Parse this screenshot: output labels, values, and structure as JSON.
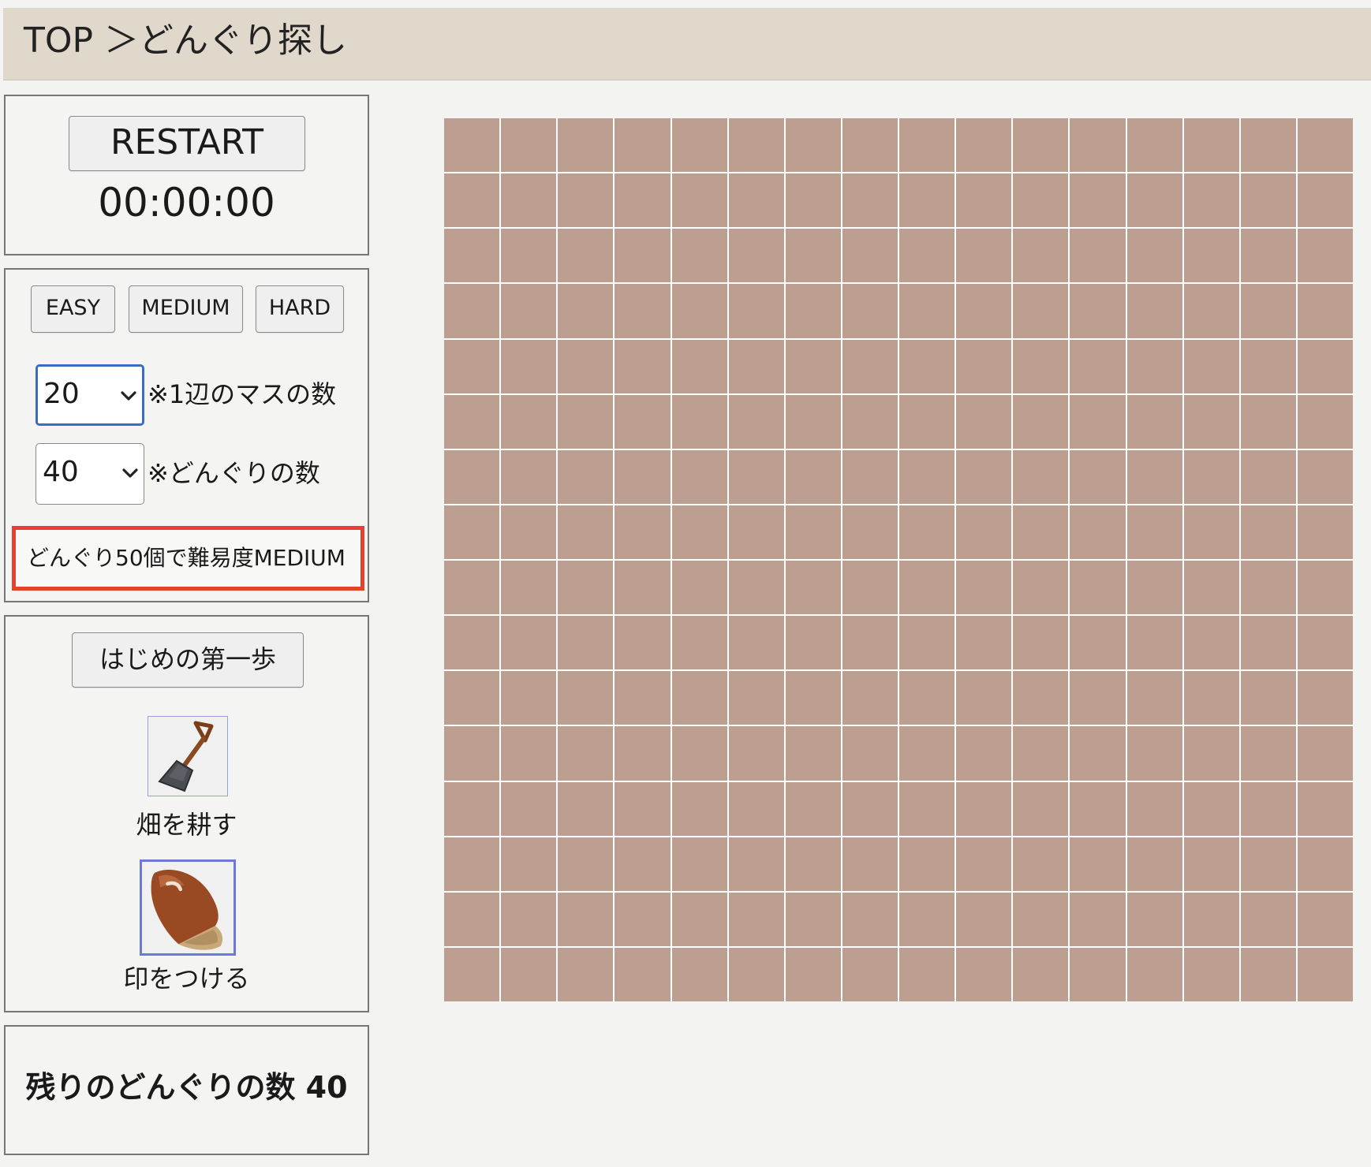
{
  "header": {
    "breadcrumb": "TOP ＞どんぐり探し"
  },
  "controls": {
    "restart_label": "RESTART",
    "timer": "00:00:00"
  },
  "difficulty": {
    "easy_label": "EASY",
    "medium_label": "MEDIUM",
    "hard_label": "HARD",
    "grid_size_value": "20",
    "grid_size_note": "※1辺のマスの数",
    "acorn_count_value": "40",
    "acorn_count_note": "※どんぐりの数",
    "hint": "どんぐり50個で難易度MEDIUM"
  },
  "tools": {
    "first_step_label": "はじめの第一歩",
    "dig_label": "畑を耕す",
    "dig_icon": "shovel-icon",
    "mark_label": "印をつける",
    "mark_icon": "acorn-icon",
    "selected_tool": "mark"
  },
  "status": {
    "remaining_text": "残りのどんぐりの数 40"
  },
  "board": {
    "visible_rows": 16,
    "visible_cols": 16,
    "cell_color": "#bd9f92",
    "grid_line_color": "#ffffff"
  },
  "colors": {
    "header_bg": "#e0d8cb",
    "hint_border": "#e8402f",
    "focus_border": "#3c6cbf",
    "selected_tool_border": "#6e78d8"
  }
}
